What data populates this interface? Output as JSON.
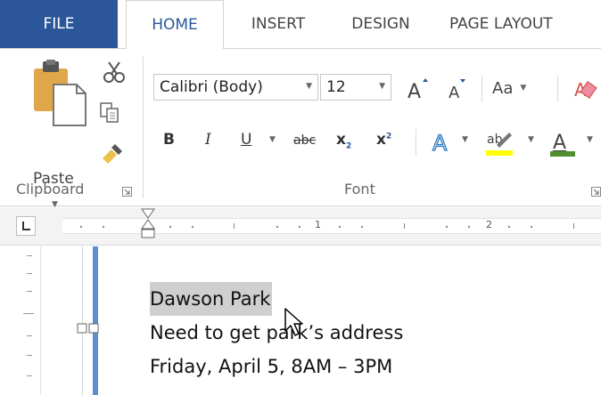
{
  "tabs": {
    "file": "FILE",
    "home": "HOME",
    "insert": "INSERT",
    "design": "DESIGN",
    "page_layout": "PAGE LAYOUT"
  },
  "ribbon": {
    "clipboard": {
      "paste_label": "Paste",
      "group_label": "Clipboard",
      "icons": [
        "paste-icon",
        "cut-icon",
        "copy-icon",
        "format-painter-icon"
      ]
    },
    "font": {
      "font_name": "Calibri (Body)",
      "font_size": "12",
      "change_case_label": "Aa",
      "bold": "B",
      "italic": "I",
      "underline": "U",
      "strikethrough": "abc",
      "subscript": "x",
      "superscript": "x",
      "group_label": "Font",
      "icons": [
        "grow-font-icon",
        "shrink-font-icon",
        "clear-formatting-icon",
        "text-effects-icon",
        "highlight-icon",
        "font-color-icon"
      ],
      "highlight_color": "#ffff00",
      "font_color": "#4f8f2f"
    }
  },
  "ruler": {
    "numbers": [
      "1",
      "2"
    ]
  },
  "document": {
    "lines": [
      "Dawson Park",
      "Need to get park’s address",
      "Friday, April 5, 8AM – 3PM"
    ],
    "selected_line_index": 0
  },
  "colors": {
    "accent": "#2b579a",
    "margin_bar": "#5b8fd0"
  }
}
